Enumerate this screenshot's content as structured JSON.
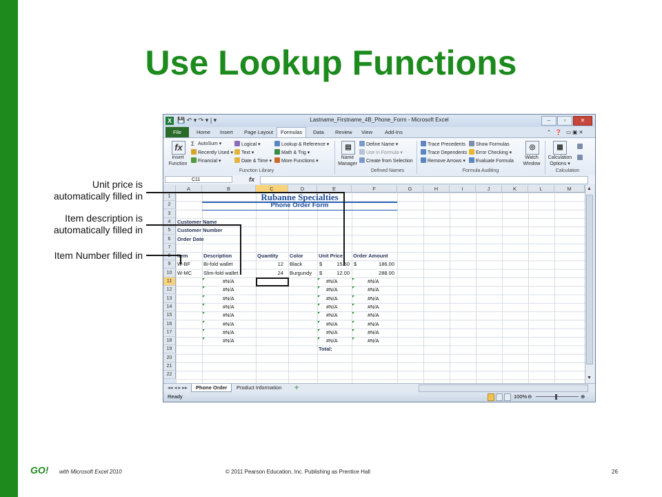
{
  "slide": {
    "title": "Use Lookup Functions",
    "callouts": {
      "unit_price": [
        "Unit price is",
        "automatically filled in"
      ],
      "item_description": [
        "Item description is",
        "automatically filled in"
      ],
      "item_number": "Item Number filled in"
    },
    "footer": {
      "logo": "GO!",
      "product": "with Microsoft Excel 2010",
      "copyright": "© 2011 Pearson Education, Inc. Publishing as Prentice Hall",
      "page": "26"
    },
    "colors": {
      "accent": "#1e8a1e",
      "title": "#1d8a1d"
    }
  },
  "excel": {
    "window_title": "Lastname_Firstname_4B_Phone_Form - Microsoft Excel",
    "app_icon": "X",
    "tabs": [
      "File",
      "Home",
      "Insert",
      "Page Layout",
      "Formulas",
      "Data",
      "Review",
      "View",
      "Add-Ins"
    ],
    "active_tab": "Formulas",
    "ribbon": {
      "insert_function": [
        "Insert",
        "Function"
      ],
      "autosum": "AutoSum ▾",
      "recently_used": "Recently Used ▾",
      "financial": "Financial ▾",
      "logical": "Logical ▾",
      "text": "Text ▾",
      "date_time": "Date & Time ▾",
      "lookup_reference": "Lookup & Reference ▾",
      "math_trig": "Math & Trig ▾",
      "more_functions": "More Functions ▾",
      "group_function_library": "Function Library",
      "name_manager": [
        "Name",
        "Manager"
      ],
      "define_name": "Define Name ▾",
      "use_in_formula": "Use in Formula ▾",
      "create_from_selection": "Create from Selection",
      "group_defined_names": "Defined Names",
      "trace_precedents": "Trace Precedents",
      "trace_dependents": "Trace Dependents",
      "remove_arrows": "Remove Arrows ▾",
      "show_formulas": "Show Formulas",
      "error_checking": "Error Checking ▾",
      "evaluate_formula": "Evaluate Formula",
      "group_formula_auditing": "Formula Auditing",
      "watch_window": [
        "Watch",
        "Window"
      ],
      "calculation_options": [
        "Calculation",
        "Options ▾"
      ],
      "group_calculation": "Calculation"
    },
    "name_box": "C11",
    "fx": "fx",
    "columns": [
      "A",
      "B",
      "C",
      "D",
      "E",
      "F",
      "G",
      "H",
      "I",
      "J",
      "K",
      "L",
      "M"
    ],
    "selected_column": "C",
    "rows": [
      "1",
      "2",
      "3",
      "4",
      "5",
      "6",
      "7",
      "8",
      "9",
      "10",
      "11",
      "12",
      "13",
      "14",
      "15",
      "16",
      "17",
      "18",
      "19",
      "20",
      "21",
      "22"
    ],
    "selected_row": "11",
    "sheet": {
      "company": "Rubanne Specialties",
      "form_title": "Phone Order Form",
      "labels": [
        "Customer Name",
        "Customer Number",
        "Order Date"
      ],
      "headers": [
        "Item",
        "Description",
        "Quantity",
        "Color",
        "Unit Price",
        "Order Amount"
      ],
      "rows": [
        {
          "item": "W-BF",
          "description": "Bi-fold wallet",
          "quantity": "12",
          "color": "Black",
          "currency": "$",
          "unit_price": "15.50",
          "amount_currency": "$",
          "amount": "186.00"
        },
        {
          "item": "W-MC",
          "description": "Slim-fold wallet",
          "quantity": "24",
          "color": "Burgundy",
          "currency": "$",
          "unit_price": "12.00",
          "amount_currency": "",
          "amount": "288.00"
        }
      ],
      "na_value": "#N/A",
      "total_label": "Total:"
    },
    "sheet_tabs": [
      "Phone Order",
      "Product Information"
    ],
    "status": "Ready",
    "zoom": "100%"
  }
}
